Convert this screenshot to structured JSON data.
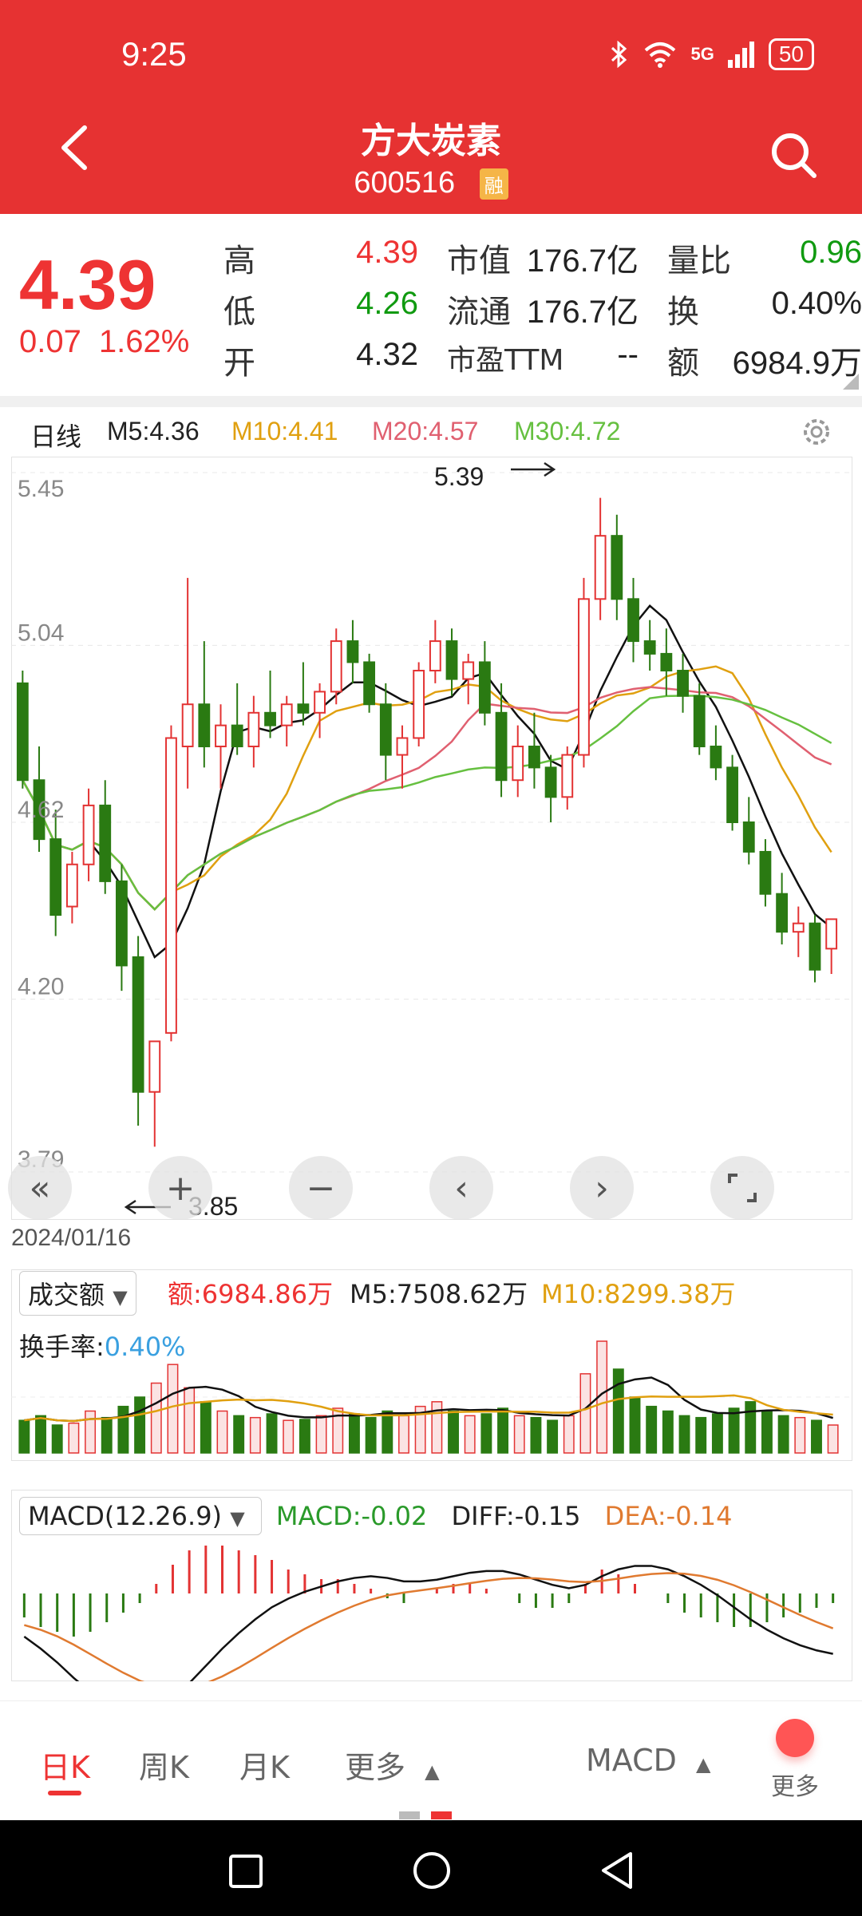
{
  "status": {
    "time": "9:25",
    "network": "5G",
    "battery": "50"
  },
  "header": {
    "title": "方大炭素",
    "code": "600516",
    "badge": "融"
  },
  "quote": {
    "price": "4.39",
    "change": "0.07",
    "change_pct": "1.62%",
    "rows": [
      {
        "l1": "高",
        "v1": "4.39",
        "l2": "市值",
        "v2": "176.7亿",
        "l3": "量比",
        "v3": "0.96"
      },
      {
        "l1": "低",
        "v1": "4.26",
        "l2": "流通",
        "v2": "176.7亿",
        "l3": "换",
        "v3": "0.40%"
      },
      {
        "l1": "开",
        "v1": "4.32",
        "l2": "市盈TTM",
        "v2": "--",
        "l3": "额",
        "v3": "6984.9万"
      }
    ]
  },
  "ma": {
    "period": "日线",
    "m5": "M5:4.36",
    "m10": "M10:4.41",
    "m20": "M20:4.57",
    "m30": "M30:4.72"
  },
  "chart_labels": {
    "y": [
      "5.45",
      "5.04",
      "4.62",
      "4.20",
      "3.79"
    ],
    "high": "5.39",
    "low": "3.85",
    "date": "2024/01/16"
  },
  "volume": {
    "selector": "成交额",
    "amount": "额:6984.86万",
    "m5": "M5:7508.62万",
    "m10": "M10:8299.38万",
    "turnover_label": "换手率:",
    "turnover": "0.40%"
  },
  "macd": {
    "selector": "MACD(12.26.9)",
    "macd": "MACD:-0.02",
    "diff": "DIFF:-0.15",
    "dea": "DEA:-0.14"
  },
  "tabs": {
    "day": "日K",
    "week": "周K",
    "month": "月K",
    "more": "更多",
    "indicator": "MACD",
    "more2": "更多"
  },
  "colors": {
    "up": "#e33333",
    "down": "#2a7a12",
    "m5": "#111111",
    "m10": "#e0a010",
    "m20": "#e06070",
    "m30": "#66c040",
    "header": "#e63232"
  },
  "chart_data": [
    {
      "type": "candlestick",
      "title": "日线",
      "ylim": [
        3.79,
        5.45
      ],
      "y_ticks": [
        "5.45",
        "5.04",
        "4.62",
        "4.20",
        "3.79"
      ],
      "x_label": "2024/01/16",
      "candles": [
        [
          4.95,
          4.98,
          4.7,
          4.72
        ],
        [
          4.72,
          4.8,
          4.55,
          4.58
        ],
        [
          4.58,
          4.65,
          4.35,
          4.4
        ],
        [
          4.42,
          4.55,
          4.38,
          4.52
        ],
        [
          4.52,
          4.7,
          4.48,
          4.66
        ],
        [
          4.66,
          4.72,
          4.45,
          4.48
        ],
        [
          4.48,
          4.52,
          4.22,
          4.28
        ],
        [
          4.3,
          4.35,
          3.9,
          3.98
        ],
        [
          3.98,
          4.05,
          3.85,
          4.1
        ],
        [
          4.12,
          4.85,
          4.1,
          4.82
        ],
        [
          4.8,
          5.2,
          4.7,
          4.9
        ],
        [
          4.9,
          5.05,
          4.75,
          4.8
        ],
        [
          4.8,
          4.9,
          4.7,
          4.85
        ],
        [
          4.85,
          4.95,
          4.78,
          4.8
        ],
        [
          4.8,
          4.92,
          4.75,
          4.88
        ],
        [
          4.88,
          4.98,
          4.82,
          4.85
        ],
        [
          4.85,
          4.92,
          4.8,
          4.9
        ],
        [
          4.9,
          5.0,
          4.85,
          4.88
        ],
        [
          4.88,
          4.95,
          4.82,
          4.93
        ],
        [
          4.93,
          5.08,
          4.9,
          5.05
        ],
        [
          5.05,
          5.1,
          4.95,
          5.0
        ],
        [
          5.0,
          5.02,
          4.88,
          4.9
        ],
        [
          4.9,
          4.95,
          4.72,
          4.78
        ],
        [
          4.78,
          4.85,
          4.7,
          4.82
        ],
        [
          4.82,
          5.0,
          4.8,
          4.98
        ],
        [
          4.98,
          5.1,
          4.95,
          5.05
        ],
        [
          5.05,
          5.08,
          4.92,
          4.96
        ],
        [
          4.96,
          5.02,
          4.9,
          5.0
        ],
        [
          5.0,
          5.05,
          4.85,
          4.88
        ],
        [
          4.88,
          4.95,
          4.68,
          4.72
        ],
        [
          4.72,
          4.85,
          4.68,
          4.8
        ],
        [
          4.8,
          4.88,
          4.7,
          4.75
        ],
        [
          4.75,
          4.78,
          4.62,
          4.68
        ],
        [
          4.68,
          4.8,
          4.65,
          4.78
        ],
        [
          4.78,
          5.2,
          4.75,
          5.15
        ],
        [
          5.15,
          5.39,
          5.1,
          5.3
        ],
        [
          5.3,
          5.35,
          5.1,
          5.15
        ],
        [
          5.15,
          5.2,
          5.0,
          5.05
        ],
        [
          5.05,
          5.1,
          4.98,
          5.02
        ],
        [
          5.02,
          5.08,
          4.92,
          4.98
        ],
        [
          4.98,
          5.02,
          4.88,
          4.92
        ],
        [
          4.92,
          4.95,
          4.78,
          4.8
        ],
        [
          4.8,
          4.85,
          4.72,
          4.75
        ],
        [
          4.75,
          4.78,
          4.6,
          4.62
        ],
        [
          4.62,
          4.68,
          4.52,
          4.55
        ],
        [
          4.55,
          4.58,
          4.42,
          4.45
        ],
        [
          4.45,
          4.5,
          4.33,
          4.36
        ],
        [
          4.36,
          4.42,
          4.3,
          4.38
        ],
        [
          4.38,
          4.4,
          4.24,
          4.27
        ],
        [
          4.32,
          4.39,
          4.26,
          4.39
        ]
      ],
      "series": [
        {
          "name": "M5",
          "value": "4.36"
        },
        {
          "name": "M10",
          "value": "4.41"
        },
        {
          "name": "M20",
          "value": "4.57"
        },
        {
          "name": "M30",
          "value": "4.72"
        }
      ],
      "annotations": {
        "max": "5.39",
        "min": "3.85"
      }
    },
    {
      "type": "bar",
      "title": "成交额",
      "values": [
        35,
        40,
        30,
        32,
        45,
        38,
        50,
        60,
        75,
        95,
        70,
        55,
        45,
        40,
        38,
        42,
        35,
        36,
        40,
        48,
        42,
        38,
        45,
        40,
        50,
        55,
        45,
        40,
        42,
        48,
        40,
        38,
        35,
        40,
        85,
        120,
        90,
        60,
        50,
        45,
        40,
        38,
        42,
        48,
        55,
        45,
        40,
        38,
        35,
        30
      ],
      "series": [
        {
          "name": "M5",
          "value": "7508.62万"
        },
        {
          "name": "M10",
          "value": "8299.38万"
        }
      ]
    },
    {
      "type": "bar",
      "title": "MACD(12.26.9)",
      "values": [
        -0.05,
        -0.07,
        -0.08,
        -0.09,
        -0.08,
        -0.06,
        -0.04,
        -0.02,
        0.02,
        0.06,
        0.09,
        0.1,
        0.1,
        0.09,
        0.08,
        0.07,
        0.05,
        0.04,
        0.03,
        0.03,
        0.02,
        0.01,
        -0.01,
        -0.02,
        0.0,
        0.01,
        0.02,
        0.02,
        0.01,
        0.0,
        -0.02,
        -0.03,
        -0.03,
        -0.02,
        0.02,
        0.05,
        0.04,
        0.02,
        0.0,
        -0.02,
        -0.04,
        -0.05,
        -0.06,
        -0.07,
        -0.07,
        -0.06,
        -0.05,
        -0.04,
        -0.03,
        -0.02
      ],
      "series": [
        {
          "name": "MACD",
          "value": "-0.02"
        },
        {
          "name": "DIFF",
          "value": "-0.15"
        },
        {
          "name": "DEA",
          "value": "-0.14"
        }
      ]
    }
  ]
}
